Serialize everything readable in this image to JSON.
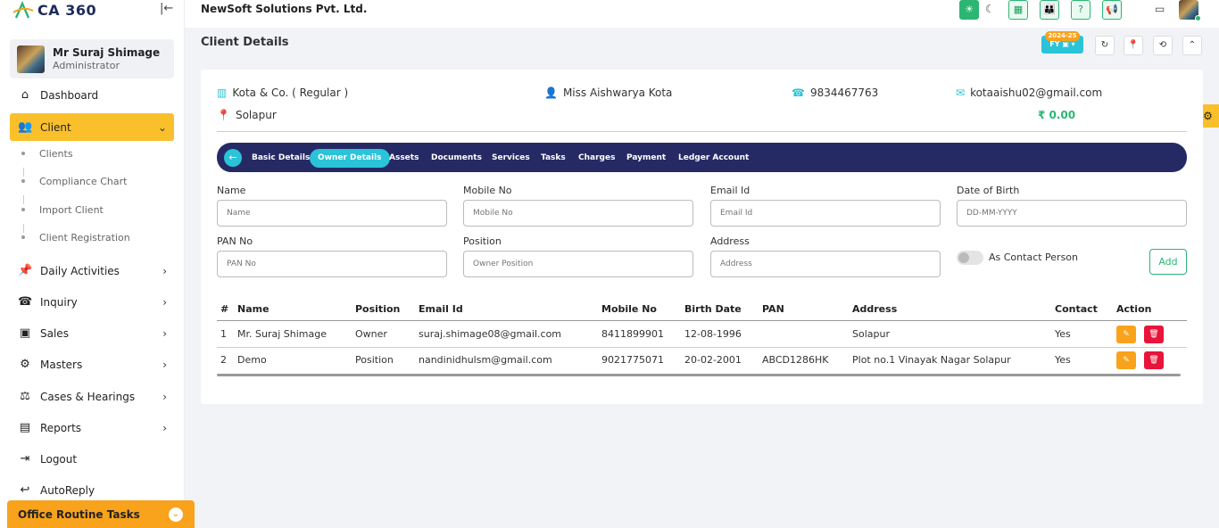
{
  "app": {
    "logo": "CA 360",
    "company": "NewSoft Solutions Pvt. Ltd."
  },
  "profile": {
    "name": "Mr Suraj Shimage",
    "role": "Administrator"
  },
  "sidebar": {
    "items": [
      {
        "label": "Dashboard"
      },
      {
        "label": "Client"
      },
      {
        "label": "Daily Activities"
      },
      {
        "label": "Inquiry"
      },
      {
        "label": "Sales"
      },
      {
        "label": "Masters"
      },
      {
        "label": "Cases & Hearings"
      },
      {
        "label": "Reports"
      },
      {
        "label": "Logout"
      },
      {
        "label": "AutoReply"
      }
    ],
    "client_sub": [
      "Clients",
      "Compliance Chart",
      "Import Client",
      "Client Registration"
    ],
    "office_routine": "Office Routine Tasks"
  },
  "header": {
    "title": "Client Details",
    "fy_year": "2024-25",
    "fy_label": "FY ▣ ▾"
  },
  "client": {
    "firm": "Kota & Co. ( Regular )",
    "contact": "Miss Aishwarya Kota",
    "phone": "9834467763",
    "email": "kotaaishu02@gmail.com",
    "city": "Solapur",
    "balance": "₹ 0.00"
  },
  "tabs": [
    "Basic Details",
    "Owner Details",
    "Assets",
    "Documents",
    "Services",
    "Tasks",
    "Charges",
    "Payment",
    "Ledger Account"
  ],
  "form": {
    "name_label": "Name",
    "name_ph": "Name",
    "mobile_label": "Mobile No",
    "mobile_ph": "Mobile No",
    "email_label": "Email Id",
    "email_ph": "Email Id",
    "dob_label": "Date of Birth",
    "dob_ph": "DD-MM-YYYY",
    "pan_label": "PAN No",
    "pan_ph": "PAN No",
    "position_label": "Position",
    "position_ph": "Owner Position",
    "address_label": "Address",
    "address_ph": "Address",
    "contact_toggle": "As Contact Person",
    "add_label": "Add"
  },
  "table": {
    "headers": [
      "#",
      "Name",
      "Position",
      "Email Id",
      "Mobile No",
      "Birth Date",
      "PAN",
      "Address",
      "Contact",
      "Action"
    ],
    "rows": [
      [
        "1",
        "Mr. Suraj Shimage",
        "Owner",
        "suraj.shimage08@gmail.com",
        "8411899901",
        "12-08-1996",
        "",
        "Solapur",
        "Yes"
      ],
      [
        "2",
        "Demo",
        "Position",
        "nandinidhulsm@gmail.com",
        "9021775071",
        "20-02-2001",
        "ABCD1286HK",
        "Plot no.1 Vinayak Nagar Solapur",
        "Yes"
      ]
    ]
  },
  "colors": {
    "accent": "#f9c02c",
    "primary_dark": "#262a64",
    "cyan": "#2ac3d8",
    "green": "#2bb673",
    "red": "#e8143a",
    "orange": "#f9a21b"
  }
}
